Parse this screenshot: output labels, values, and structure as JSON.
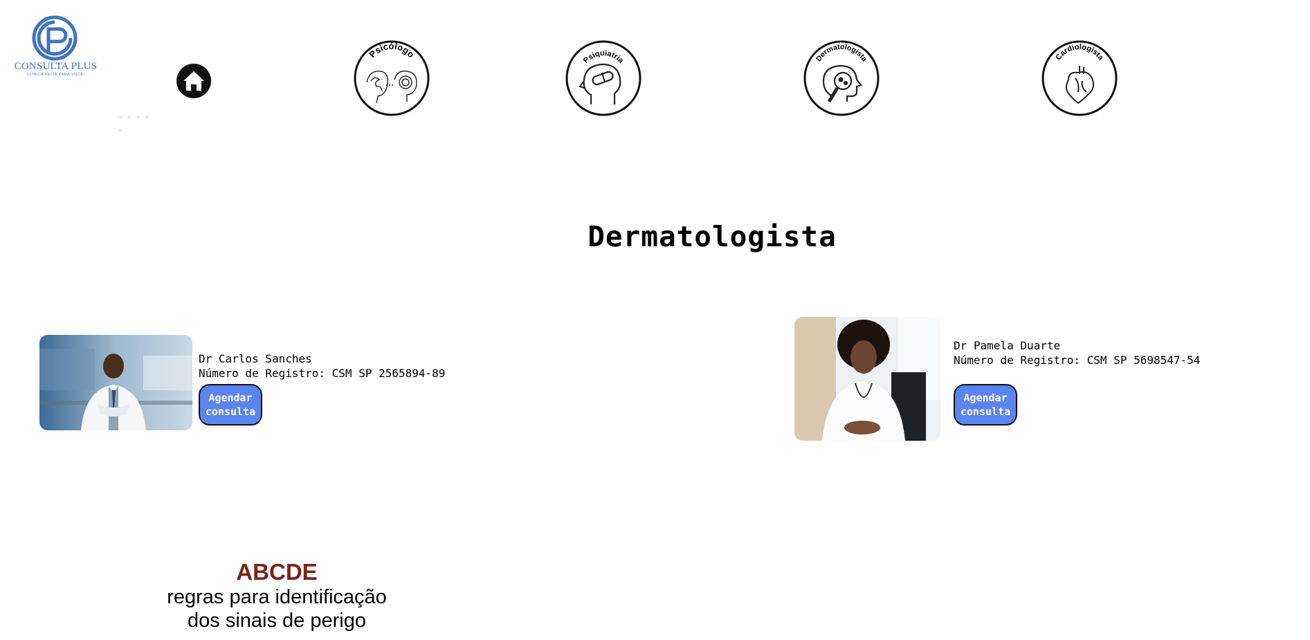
{
  "brand": {
    "name": "CONSULTA PLUS",
    "tagline": "CLÍNICA FEITA PARA VOCÊ!",
    "color": "#3f73c4"
  },
  "nav": {
    "home_icon": "home-icon",
    "specialties": [
      {
        "label": "Psicólogo",
        "icon": "brain-psychology-icon"
      },
      {
        "label": "Psiquiatria",
        "icon": "head-pill-icon"
      },
      {
        "label": "Dermatologista",
        "icon": "head-magnifier-icon"
      },
      {
        "label": "Cardiologista",
        "icon": "heart-icon"
      }
    ]
  },
  "page": {
    "title": "Dermatologista"
  },
  "doctors": [
    {
      "name": "Dr Carlos Sanches",
      "registration": "Número de Registro: CSM SP 2565894-89",
      "button_line1": "Agendar",
      "button_line2": "consulta"
    },
    {
      "name": "Dr Pamela Duarte",
      "registration": "Número de Registro: CSM SP 5698547-54",
      "button_line1": "Agendar",
      "button_line2": "consulta"
    }
  ],
  "info_banner": {
    "title": "ABCDE",
    "line1": "regras para identificação",
    "line2": "dos sinais de perigo"
  },
  "colors": {
    "button_bg": "#5a84f0",
    "abcde_title": "#7a2418"
  }
}
